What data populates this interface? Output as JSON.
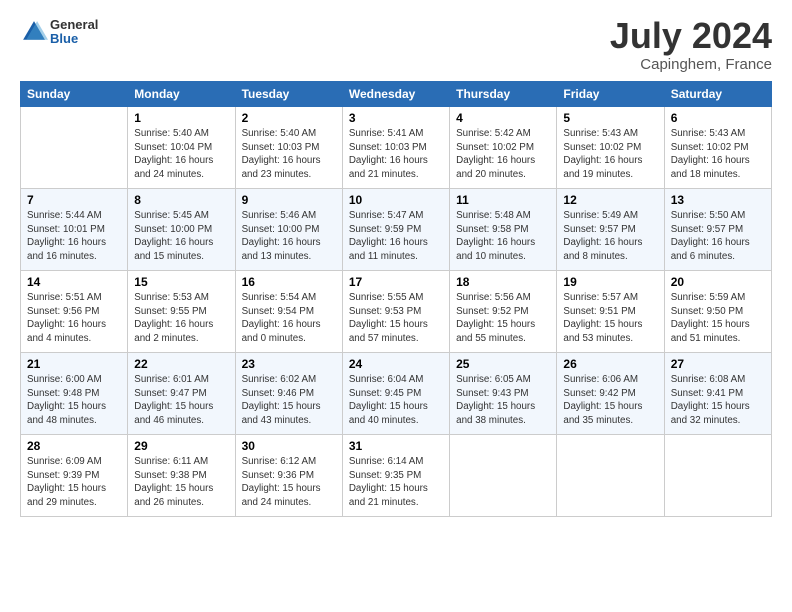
{
  "header": {
    "logo_general": "General",
    "logo_blue": "Blue",
    "month_title": "July 2024",
    "location": "Capinghem, France"
  },
  "days_of_week": [
    "Sunday",
    "Monday",
    "Tuesday",
    "Wednesday",
    "Thursday",
    "Friday",
    "Saturday"
  ],
  "weeks": [
    [
      {
        "day": "",
        "info": ""
      },
      {
        "day": "1",
        "info": "Sunrise: 5:40 AM\nSunset: 10:04 PM\nDaylight: 16 hours\nand 24 minutes."
      },
      {
        "day": "2",
        "info": "Sunrise: 5:40 AM\nSunset: 10:03 PM\nDaylight: 16 hours\nand 23 minutes."
      },
      {
        "day": "3",
        "info": "Sunrise: 5:41 AM\nSunset: 10:03 PM\nDaylight: 16 hours\nand 21 minutes."
      },
      {
        "day": "4",
        "info": "Sunrise: 5:42 AM\nSunset: 10:02 PM\nDaylight: 16 hours\nand 20 minutes."
      },
      {
        "day": "5",
        "info": "Sunrise: 5:43 AM\nSunset: 10:02 PM\nDaylight: 16 hours\nand 19 minutes."
      },
      {
        "day": "6",
        "info": "Sunrise: 5:43 AM\nSunset: 10:02 PM\nDaylight: 16 hours\nand 18 minutes."
      }
    ],
    [
      {
        "day": "7",
        "info": "Sunrise: 5:44 AM\nSunset: 10:01 PM\nDaylight: 16 hours\nand 16 minutes."
      },
      {
        "day": "8",
        "info": "Sunrise: 5:45 AM\nSunset: 10:00 PM\nDaylight: 16 hours\nand 15 minutes."
      },
      {
        "day": "9",
        "info": "Sunrise: 5:46 AM\nSunset: 10:00 PM\nDaylight: 16 hours\nand 13 minutes."
      },
      {
        "day": "10",
        "info": "Sunrise: 5:47 AM\nSunset: 9:59 PM\nDaylight: 16 hours\nand 11 minutes."
      },
      {
        "day": "11",
        "info": "Sunrise: 5:48 AM\nSunset: 9:58 PM\nDaylight: 16 hours\nand 10 minutes."
      },
      {
        "day": "12",
        "info": "Sunrise: 5:49 AM\nSunset: 9:57 PM\nDaylight: 16 hours\nand 8 minutes."
      },
      {
        "day": "13",
        "info": "Sunrise: 5:50 AM\nSunset: 9:57 PM\nDaylight: 16 hours\nand 6 minutes."
      }
    ],
    [
      {
        "day": "14",
        "info": "Sunrise: 5:51 AM\nSunset: 9:56 PM\nDaylight: 16 hours\nand 4 minutes."
      },
      {
        "day": "15",
        "info": "Sunrise: 5:53 AM\nSunset: 9:55 PM\nDaylight: 16 hours\nand 2 minutes."
      },
      {
        "day": "16",
        "info": "Sunrise: 5:54 AM\nSunset: 9:54 PM\nDaylight: 16 hours\nand 0 minutes."
      },
      {
        "day": "17",
        "info": "Sunrise: 5:55 AM\nSunset: 9:53 PM\nDaylight: 15 hours\nand 57 minutes."
      },
      {
        "day": "18",
        "info": "Sunrise: 5:56 AM\nSunset: 9:52 PM\nDaylight: 15 hours\nand 55 minutes."
      },
      {
        "day": "19",
        "info": "Sunrise: 5:57 AM\nSunset: 9:51 PM\nDaylight: 15 hours\nand 53 minutes."
      },
      {
        "day": "20",
        "info": "Sunrise: 5:59 AM\nSunset: 9:50 PM\nDaylight: 15 hours\nand 51 minutes."
      }
    ],
    [
      {
        "day": "21",
        "info": "Sunrise: 6:00 AM\nSunset: 9:48 PM\nDaylight: 15 hours\nand 48 minutes."
      },
      {
        "day": "22",
        "info": "Sunrise: 6:01 AM\nSunset: 9:47 PM\nDaylight: 15 hours\nand 46 minutes."
      },
      {
        "day": "23",
        "info": "Sunrise: 6:02 AM\nSunset: 9:46 PM\nDaylight: 15 hours\nand 43 minutes."
      },
      {
        "day": "24",
        "info": "Sunrise: 6:04 AM\nSunset: 9:45 PM\nDaylight: 15 hours\nand 40 minutes."
      },
      {
        "day": "25",
        "info": "Sunrise: 6:05 AM\nSunset: 9:43 PM\nDaylight: 15 hours\nand 38 minutes."
      },
      {
        "day": "26",
        "info": "Sunrise: 6:06 AM\nSunset: 9:42 PM\nDaylight: 15 hours\nand 35 minutes."
      },
      {
        "day": "27",
        "info": "Sunrise: 6:08 AM\nSunset: 9:41 PM\nDaylight: 15 hours\nand 32 minutes."
      }
    ],
    [
      {
        "day": "28",
        "info": "Sunrise: 6:09 AM\nSunset: 9:39 PM\nDaylight: 15 hours\nand 29 minutes."
      },
      {
        "day": "29",
        "info": "Sunrise: 6:11 AM\nSunset: 9:38 PM\nDaylight: 15 hours\nand 26 minutes."
      },
      {
        "day": "30",
        "info": "Sunrise: 6:12 AM\nSunset: 9:36 PM\nDaylight: 15 hours\nand 24 minutes."
      },
      {
        "day": "31",
        "info": "Sunrise: 6:14 AM\nSunset: 9:35 PM\nDaylight: 15 hours\nand 21 minutes."
      },
      {
        "day": "",
        "info": ""
      },
      {
        "day": "",
        "info": ""
      },
      {
        "day": "",
        "info": ""
      }
    ]
  ]
}
